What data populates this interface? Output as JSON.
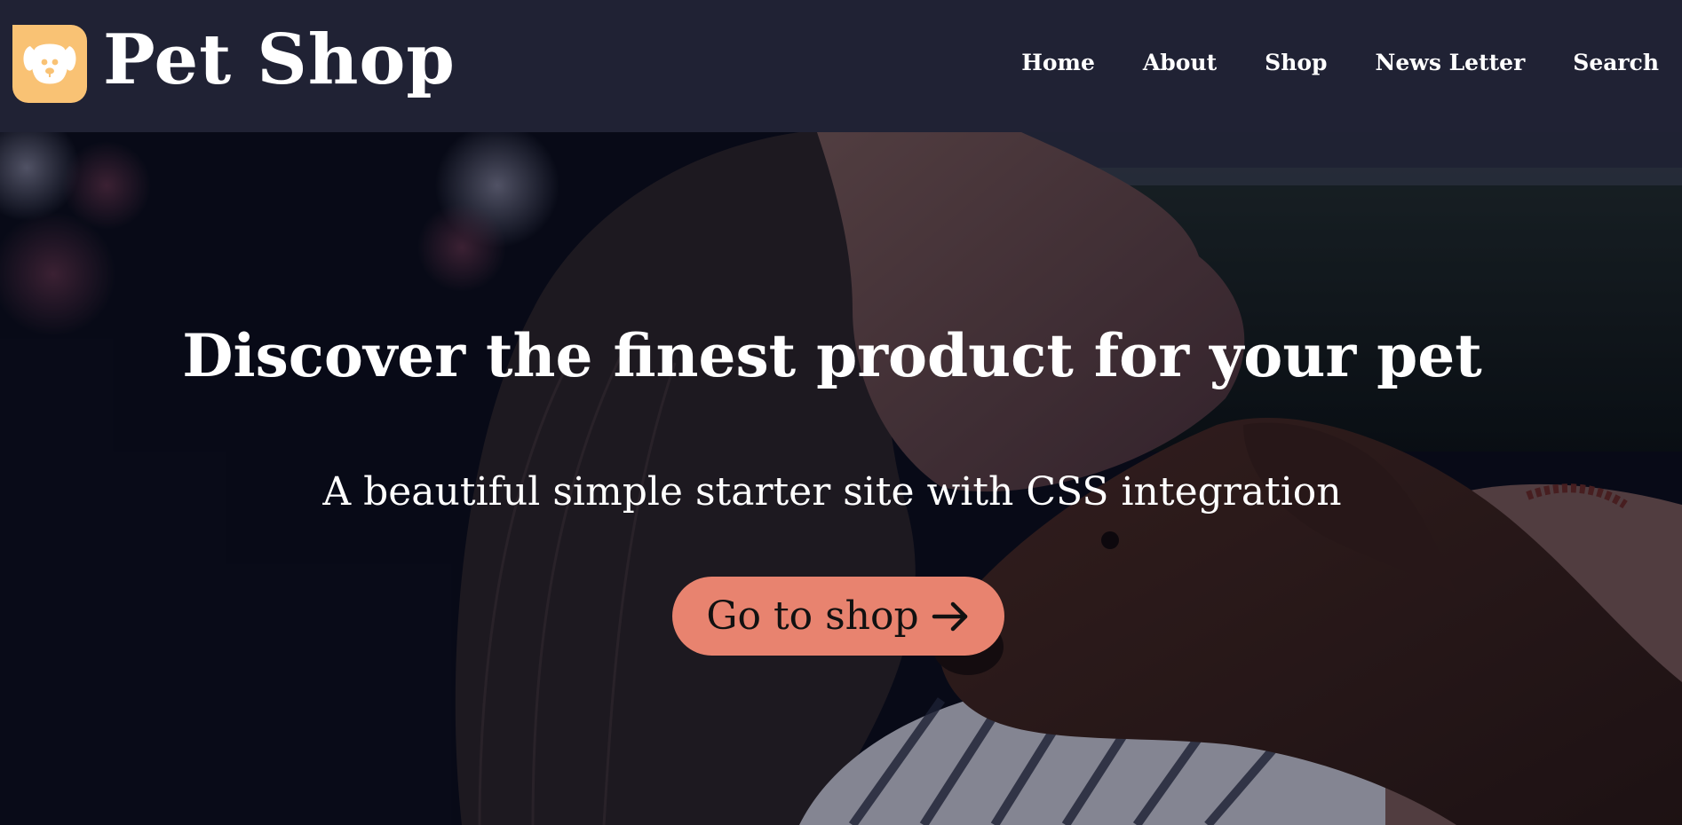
{
  "brand": {
    "name": "Pet Shop",
    "logo_icon": "dog-face-icon",
    "logo_color": "#f9c274"
  },
  "nav": {
    "items": [
      {
        "label": "Home"
      },
      {
        "label": "About"
      },
      {
        "label": "Shop"
      },
      {
        "label": "News Letter"
      },
      {
        "label": "Search"
      }
    ]
  },
  "hero": {
    "title": "Discover the finest product for your pet",
    "subtitle": "A beautiful simple starter site with CSS integration",
    "cta_label": "Go to shop",
    "cta_icon": "arrow-right-icon",
    "cta_color": "#e8836f",
    "background_image": "woman-hugging-brown-dog-photo"
  },
  "colors": {
    "navbar_bg": "#202234",
    "text": "#ffffff"
  }
}
